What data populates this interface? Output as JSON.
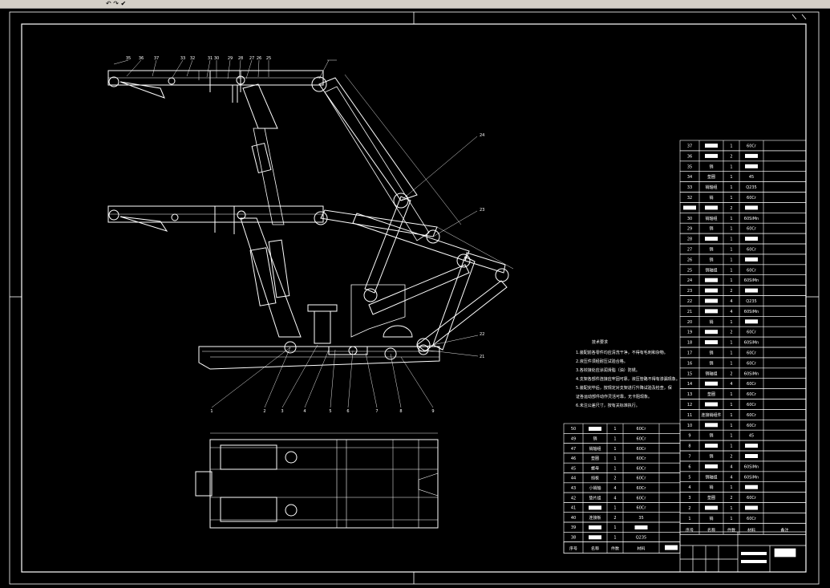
{
  "toolbar": {
    "glyphs": "↶ ↷ ✔"
  },
  "tech_requirements": {
    "title": "技术要求",
    "lines": [
      "1.装配前各零件均应清洗干净，不得有毛刺和杂物。",
      "2.液压件须经耐压试验合格。",
      "3.各铰接处应涂润滑脂（油）防锈。",
      "4.支架各部件连接应牢固可靠，液压管路不得有渗漏现象。",
      "5.装配完毕后，按规定对支架进行升降试验及检查，保",
      "证各运动部件动作灵活可靠，无卡阻现象。",
      "6.未注公差尺寸，按有关标准执行。"
    ]
  },
  "bom_right": {
    "rows": [
      {
        "no": "37",
        "name": "▬",
        "qty": "1",
        "mat": "60Cr"
      },
      {
        "no": "36",
        "name": "▬",
        "qty": "2",
        "mat": "▬"
      },
      {
        "no": "35",
        "name": "销",
        "qty": "1",
        "mat": "▬"
      },
      {
        "no": "34",
        "name": "垫圈",
        "qty": "1",
        "mat": "45"
      },
      {
        "no": "33",
        "name": "销轴组",
        "qty": "1",
        "mat": "Q235"
      },
      {
        "no": "32",
        "name": "销",
        "qty": "1",
        "mat": "60Cr"
      },
      {
        "no": "▬",
        "name": "▬",
        "qty": "2",
        "mat": "▬"
      },
      {
        "no": "30",
        "name": "销轴组",
        "qty": "1",
        "mat": "60SiMn"
      },
      {
        "no": "29",
        "name": "销",
        "qty": "1",
        "mat": "60Cr"
      },
      {
        "no": "28",
        "name": "▬",
        "qty": "1",
        "mat": "▬"
      },
      {
        "no": "27",
        "name": "销",
        "qty": "1",
        "mat": "60Cr"
      },
      {
        "no": "26",
        "name": "销",
        "qty": "1",
        "mat": "▬"
      },
      {
        "no": "25",
        "name": "销轴组",
        "qty": "1",
        "mat": "60Cr"
      },
      {
        "no": "24",
        "name": "▬",
        "qty": "1",
        "mat": "60SiMn"
      },
      {
        "no": "23",
        "name": "▬",
        "qty": "2",
        "mat": "▬"
      },
      {
        "no": "22",
        "name": "▬",
        "qty": "4",
        "mat": "Q235"
      },
      {
        "no": "21",
        "name": "▬",
        "qty": "4",
        "mat": "60SiMn"
      },
      {
        "no": "20",
        "name": "销",
        "qty": "1",
        "mat": "▬"
      },
      {
        "no": "19",
        "name": "▬",
        "qty": "2",
        "mat": "60Cr"
      },
      {
        "no": "18",
        "name": "▬",
        "qty": "1",
        "mat": "60SiMn"
      },
      {
        "no": "17",
        "name": "销",
        "qty": "1",
        "mat": "60Cr"
      },
      {
        "no": "16",
        "name": "销",
        "qty": "1",
        "mat": "60Cr"
      },
      {
        "no": "15",
        "name": "销轴组",
        "qty": "2",
        "mat": "60SiMn"
      },
      {
        "no": "14",
        "name": "▬",
        "qty": "4",
        "mat": "60Cr"
      },
      {
        "no": "13",
        "name": "垫圈",
        "qty": "1",
        "mat": "60Cr"
      },
      {
        "no": "12",
        "name": "▬",
        "qty": "1",
        "mat": "60Cr"
      },
      {
        "no": "11",
        "name": "连接销组件",
        "qty": "1",
        "mat": "60Cr"
      },
      {
        "no": "10",
        "name": "▬",
        "qty": "1",
        "mat": "60Cr"
      },
      {
        "no": "9",
        "name": "销",
        "qty": "1",
        "mat": "45"
      },
      {
        "no": "8",
        "name": "▬",
        "qty": "1",
        "mat": "▬"
      },
      {
        "no": "7",
        "name": "销",
        "qty": "2",
        "mat": "▬"
      },
      {
        "no": "6",
        "name": "▬",
        "qty": "4",
        "mat": "60SiMn"
      },
      {
        "no": "5",
        "name": "销轴组",
        "qty": "4",
        "mat": "60SiMn"
      },
      {
        "no": "4",
        "name": "销",
        "qty": "1",
        "mat": "▬"
      },
      {
        "no": "3",
        "name": "垫圈",
        "qty": "2",
        "mat": "60Cr"
      },
      {
        "no": "2",
        "name": "▬",
        "qty": "1",
        "mat": "▬"
      },
      {
        "no": "1",
        "name": "销",
        "qty": "1",
        "mat": "60Cr"
      }
    ],
    "header": {
      "no": "序号",
      "name": "名称",
      "qty": "件数",
      "mat": "材料",
      "note": "备注"
    }
  },
  "bom_left": {
    "rows": [
      {
        "no": "50",
        "name": "▬",
        "qty": "1",
        "mat": "60Cr"
      },
      {
        "no": "49",
        "name": "销",
        "qty": "1",
        "mat": "60Cr"
      },
      {
        "no": "47",
        "name": "销轴组",
        "qty": "1",
        "mat": "60Cr"
      },
      {
        "no": "46",
        "name": "垫圈",
        "qty": "1",
        "mat": "60Cr"
      },
      {
        "no": "45",
        "name": "螺母",
        "qty": "1",
        "mat": "60Cr"
      },
      {
        "no": "44",
        "name": "挡板",
        "qty": "2",
        "mat": "60Cr"
      },
      {
        "no": "43",
        "name": "小销轴",
        "qty": "4",
        "mat": "60Cr"
      },
      {
        "no": "42",
        "name": "垫片组",
        "qty": "4",
        "mat": "60Cr"
      },
      {
        "no": "41",
        "name": "▬",
        "qty": "1",
        "mat": "60Cr"
      },
      {
        "no": "40",
        "name": "连接板",
        "qty": "2",
        "mat": "35"
      },
      {
        "no": "39",
        "name": "▬",
        "qty": "1",
        "mat": "▬"
      },
      {
        "no": "38",
        "name": "▬",
        "qty": "1",
        "mat": "Q235"
      }
    ],
    "header": {
      "no": "序号",
      "name": "名称",
      "qty": "件数",
      "mat": "材料"
    }
  },
  "title_block": {
    "drawing_name": "装配图"
  },
  "callouts": {
    "top": [
      "35",
      "36",
      "37",
      "33",
      "32",
      "31",
      "30",
      "29",
      "28",
      "27",
      "26",
      "25"
    ],
    "right": [
      "24",
      "23",
      "22",
      "21"
    ],
    "bottom": [
      "1",
      "2",
      "3",
      "4",
      "5",
      "6",
      "7",
      "8",
      "9"
    ]
  }
}
